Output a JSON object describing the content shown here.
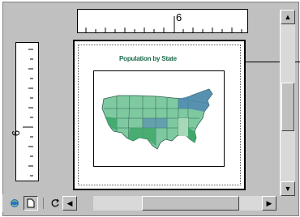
{
  "rulers": {
    "horizontal_label": "6",
    "vertical_label": "6"
  },
  "layout": {
    "map_title": "Population by State"
  },
  "scrollbar": {
    "up_arrow": "▲",
    "down_arrow": "▼",
    "left_arrow": "◀",
    "right_arrow": "▶"
  },
  "status": {
    "globe_icon": "globe-icon",
    "page_icon": "page-icon",
    "refresh_icon": "refresh-icon"
  },
  "colors": {
    "map_fill_light": "#a8d8b8",
    "map_fill_mid": "#6fbf8f",
    "map_fill_dark": "#4a7fb5",
    "title_color": "#1a6b4a"
  }
}
